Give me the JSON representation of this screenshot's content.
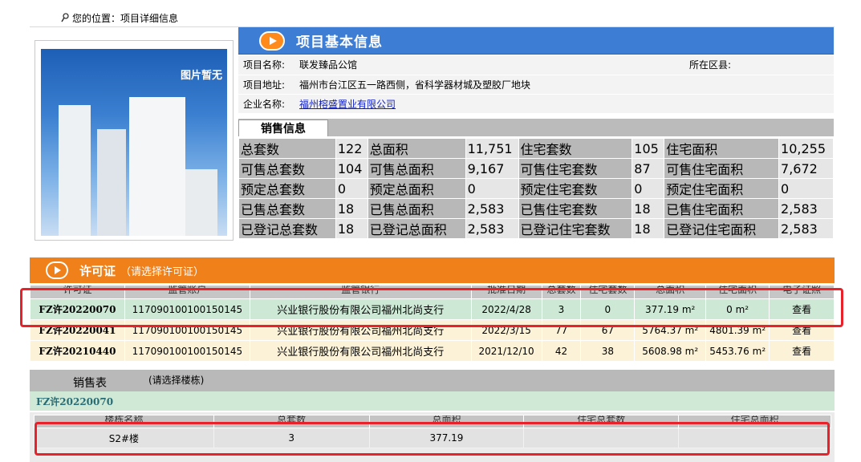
{
  "breadcrumb": {
    "text": "您的位置：项目详细信息"
  },
  "photo": {
    "placeholder": "图片暂无"
  },
  "project": {
    "title": "项目基本信息",
    "name_label": "项目名称:",
    "name": "联发臻品公馆",
    "district_label": "所在区县:",
    "district": "",
    "address_label": "项目地址:",
    "address": "福州市台江区五一路西侧，省科学器材城及塑胶厂地块",
    "company_label": "企业名称:",
    "company": "福州榕盛置业有限公司"
  },
  "sales": {
    "tab": "销售信息",
    "rows": [
      [
        "总套数",
        "122",
        "总面积",
        "11,751",
        "住宅套数",
        "105",
        "住宅面积",
        "10,255"
      ],
      [
        "可售总套数",
        "104",
        "可售总面积",
        "9,167",
        "可售住宅套数",
        "87",
        "可售住宅面积",
        "7,672"
      ],
      [
        "预定总套数",
        "0",
        "预定总面积",
        "0",
        "预定住宅套数",
        "0",
        "预定住宅面积",
        "0"
      ],
      [
        "已售总套数",
        "18",
        "已售总面积",
        "2,583",
        "已售住宅套数",
        "18",
        "已售住宅面积",
        "2,583"
      ],
      [
        "已登记总套数",
        "18",
        "已登记总面积",
        "2,583",
        "已登记住宅套数",
        "18",
        "已登记住宅面积",
        "2,583"
      ]
    ]
  },
  "licenses": {
    "title": "许可证",
    "subtitle": "（请选择许可证）",
    "columns": [
      "许可证",
      "监管账户",
      "监管银行",
      "批准日期",
      "总套数",
      "住宅套数",
      "总面积",
      "住宅面积",
      "电子证照"
    ],
    "rows": [
      {
        "id": "FZ许20220070",
        "account": "117090100100150145",
        "bank": "兴业银行股份有限公司福州北尚支行",
        "date": "2022/4/28",
        "total": "3",
        "res": "0",
        "area": "377.19 m²",
        "res_area": "0 m²",
        "view": "查看"
      },
      {
        "id": "FZ许20220041",
        "account": "117090100100150145",
        "bank": "兴业银行股份有限公司福州北尚支行",
        "date": "2022/3/15",
        "total": "77",
        "res": "67",
        "area": "5764.37 m²",
        "res_area": "4801.39 m²",
        "view": "查看"
      },
      {
        "id": "FZ许20210440",
        "account": "117090100100150145",
        "bank": "兴业银行股份有限公司福州北尚支行",
        "date": "2021/12/10",
        "total": "42",
        "res": "38",
        "area": "5608.98 m²",
        "res_area": "5453.76 m²",
        "view": "查看"
      }
    ]
  },
  "sale_table": {
    "title": "销售表",
    "hint": "(请选择楼栋)",
    "selected_license": "FZ许20220070",
    "columns": [
      "楼栋名称",
      "总套数",
      "总面积",
      "住宅总套数",
      "住宅总面积"
    ],
    "rows": [
      {
        "name": "S2#楼",
        "total": "3",
        "area": "377.19",
        "res_total": "",
        "res_area": ""
      }
    ]
  }
}
